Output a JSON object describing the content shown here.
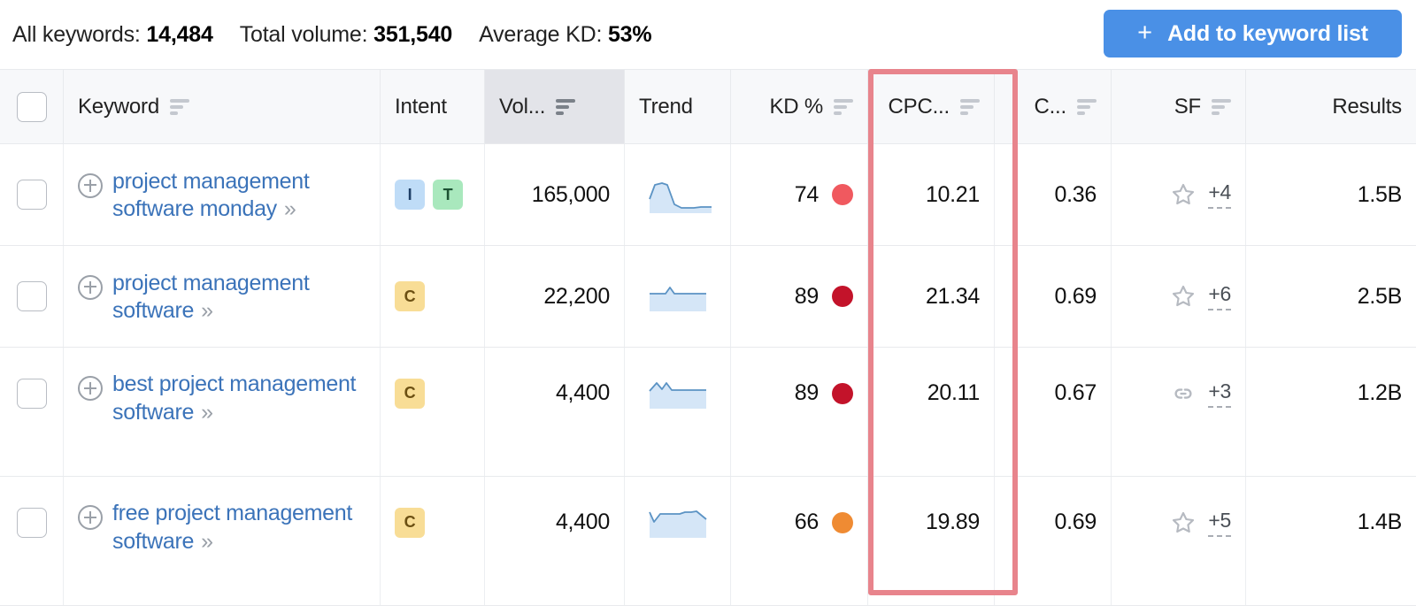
{
  "summary": {
    "stats": [
      {
        "label": "All keywords:",
        "value": "14,484"
      },
      {
        "label": "Total volume:",
        "value": "351,540"
      },
      {
        "label": "Average KD:",
        "value": "53%"
      }
    ],
    "add_button": {
      "icon": "plus-icon",
      "label": "Add to keyword list",
      "color": "#4a90e6"
    }
  },
  "table": {
    "columns": [
      {
        "key": "check",
        "label": "",
        "sortable": false,
        "align": "center",
        "active": false
      },
      {
        "key": "keyword",
        "label": "Keyword",
        "sortable": true,
        "align": "left",
        "active": false
      },
      {
        "key": "intent",
        "label": "Intent",
        "sortable": false,
        "align": "left",
        "active": false
      },
      {
        "key": "volume",
        "label": "Vol...",
        "sortable": true,
        "align": "right",
        "active": true
      },
      {
        "key": "trend",
        "label": "Trend",
        "sortable": false,
        "align": "left",
        "active": false
      },
      {
        "key": "kd",
        "label": "KD %",
        "sortable": true,
        "align": "right",
        "active": false
      },
      {
        "key": "cpc",
        "label": "CPC...",
        "sortable": true,
        "align": "right",
        "active": false
      },
      {
        "key": "com",
        "label": "C...",
        "sortable": true,
        "align": "right",
        "active": false
      },
      {
        "key": "sf",
        "label": "SF",
        "sortable": true,
        "align": "right",
        "active": false
      },
      {
        "key": "results",
        "label": "Results",
        "sortable": false,
        "align": "right",
        "active": false
      }
    ],
    "rows": [
      {
        "keyword": "project management software monday",
        "intent": [
          "I",
          "T"
        ],
        "volume": "165,000",
        "trend": "spike-then-flat",
        "kd": "74",
        "kd_color": "#f0595f",
        "cpc": "10.21",
        "com": "0.36",
        "sf_icon": "star-icon",
        "sf_count": "+4",
        "results": "1.5B"
      },
      {
        "keyword": "project management software",
        "intent": [
          "C"
        ],
        "volume": "22,200",
        "trend": "flat-with-bump",
        "kd": "89",
        "kd_color": "#c3132a",
        "cpc": "21.34",
        "com": "0.69",
        "sf_icon": "star-icon",
        "sf_count": "+6",
        "results": "2.5B"
      },
      {
        "keyword": "best project management software",
        "intent": [
          "C"
        ],
        "volume": "4,400",
        "trend": "zigzag-then-flat",
        "kd": "89",
        "kd_color": "#c3132a",
        "cpc": "20.11",
        "com": "0.67",
        "sf_icon": "link-icon",
        "sf_count": "+3",
        "results": "1.2B"
      },
      {
        "keyword": "free project management software",
        "intent": [
          "C"
        ],
        "volume": "4,400",
        "trend": "dip-rise-wave",
        "kd": "66",
        "kd_color": "#ef8b33",
        "cpc": "19.89",
        "com": "0.69",
        "sf_icon": "star-icon",
        "sf_count": "+5",
        "results": "1.4B"
      }
    ],
    "expand_chevron": "»"
  },
  "annotation": {
    "highlight_column": "cpc",
    "color": "#e8848c"
  }
}
